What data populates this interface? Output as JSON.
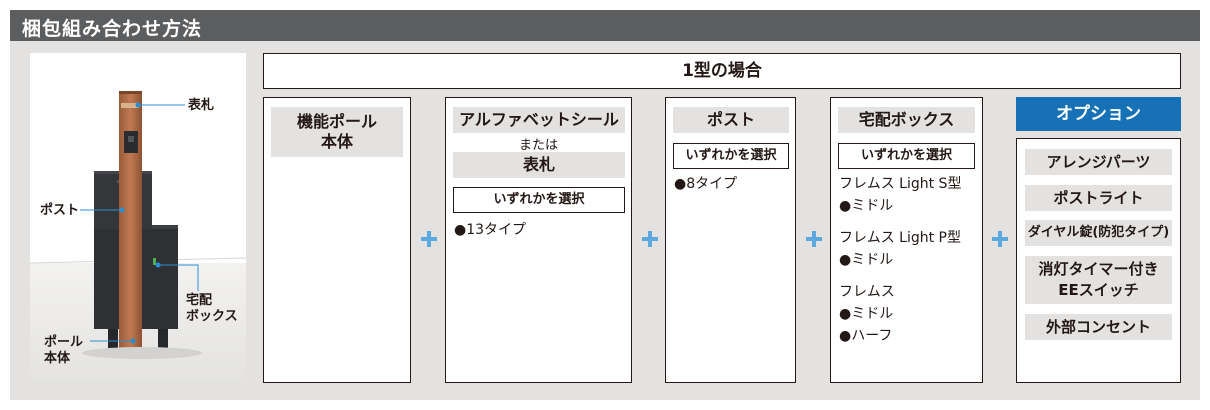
{
  "title": "梱包組み合わせ方法",
  "type_header": "1型の場合",
  "photo": {
    "labels": {
      "hyosatsu": "表札",
      "post": "ポスト",
      "takuhai": "宅配\nボックス",
      "pole": "ポール\n本体"
    }
  },
  "columns": {
    "pole": {
      "label": "機能ポール\n本体"
    },
    "alphabet": {
      "label": "アルファベットシール",
      "or": "または",
      "label2": "表札",
      "select": "いずれかを選択",
      "items": [
        "●13タイプ"
      ]
    },
    "post": {
      "label": "ポスト",
      "select": "いずれかを選択",
      "items": [
        "●8タイプ"
      ]
    },
    "takuhai": {
      "label": "宅配ボックス",
      "select": "いずれかを選択",
      "groups": [
        {
          "name": "フレムス Light S型",
          "items": [
            "●ミドル"
          ]
        },
        {
          "name": "フレムス Light P型",
          "items": [
            "●ミドル"
          ]
        },
        {
          "name": "フレムス",
          "items": [
            "●ミドル",
            "●ハーフ"
          ]
        }
      ]
    }
  },
  "options": {
    "header": "オプション",
    "items": [
      "アレンジパーツ",
      "ポストライト",
      "ダイヤル錠(防犯タイプ)",
      "消灯タイマー付き\nEEスイッチ",
      "外部コンセント"
    ]
  },
  "colors": {
    "title_bar": "#5c5d5f",
    "background": "#e3e2e0",
    "option_blue": "#1671b7",
    "plus_blue": "#5aaadf",
    "leader_blue": "#2a8fd2"
  }
}
